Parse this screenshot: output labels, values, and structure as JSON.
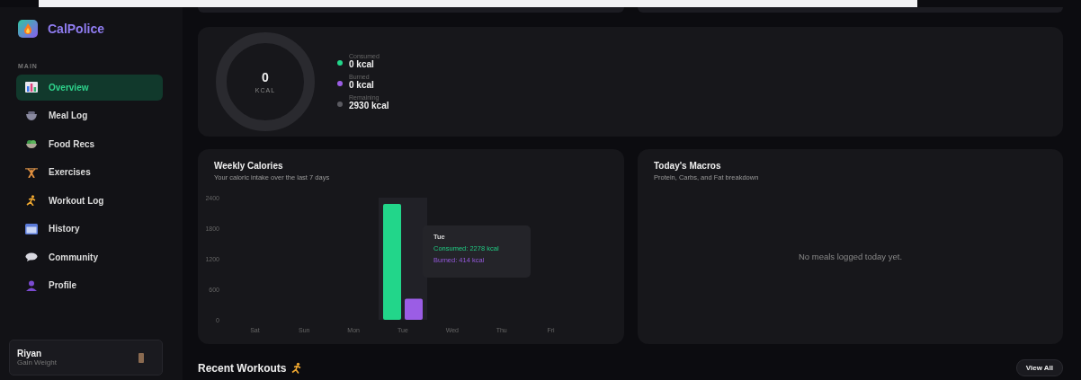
{
  "sidebar": {
    "brand": "CalPolice",
    "section": "MAIN",
    "items": [
      {
        "label": "Overview",
        "kind": "chart",
        "selected": true
      },
      {
        "label": "Meal Log",
        "kind": "bowl",
        "selected": false
      },
      {
        "label": "Food Recs",
        "kind": "salad",
        "selected": false
      },
      {
        "label": "Exercises",
        "kind": "weights",
        "selected": false
      },
      {
        "label": "Workout Log",
        "kind": "runner",
        "selected": false
      },
      {
        "label": "History",
        "kind": "calendar",
        "selected": false
      },
      {
        "label": "Community",
        "kind": "bubble",
        "selected": false
      },
      {
        "label": "Profile",
        "kind": "person",
        "selected": false
      }
    ],
    "user": {
      "name": "Riyan",
      "goal": "Gain Weight"
    }
  },
  "summary": {
    "ring_value": "0",
    "ring_unit": "KCAL",
    "stats": [
      {
        "label": "Consumed",
        "value": "0 kcal",
        "color": "#22d68a"
      },
      {
        "label": "Burned",
        "value": "0 kcal",
        "color": "#9b5de5"
      },
      {
        "label": "Remaining",
        "value": "2930 kcal",
        "color": "#5a5a60"
      }
    ]
  },
  "weekly": {
    "title": "Weekly Calories",
    "subtitle": "Your caloric intake over the last 7 days",
    "chart_data": {
      "type": "bar",
      "categories": [
        "Sat",
        "Sun",
        "Mon",
        "Tue",
        "Wed",
        "Thu",
        "Fri"
      ],
      "ylim": [
        0,
        2400
      ],
      "yticks": [
        0,
        600,
        1200,
        1800,
        2400
      ],
      "series": [
        {
          "color": "#22d68a",
          "values": [
            0,
            0,
            0,
            2278,
            0,
            0,
            0
          ]
        },
        {
          "color": "#9b5de5",
          "values": [
            0,
            0,
            0,
            414,
            0,
            0,
            0
          ]
        }
      ]
    },
    "tooltip": {
      "day": "Tue",
      "lines": [
        "Consumed: 2278 kcal",
        "Burned: 414 kcal"
      ]
    }
  },
  "macros": {
    "title": "Today's Macros",
    "subtitle": "Protein, Carbs, and Fat breakdown",
    "empty": "No meals logged today yet."
  },
  "recent": {
    "title": "Recent Workouts",
    "button": "View All"
  }
}
